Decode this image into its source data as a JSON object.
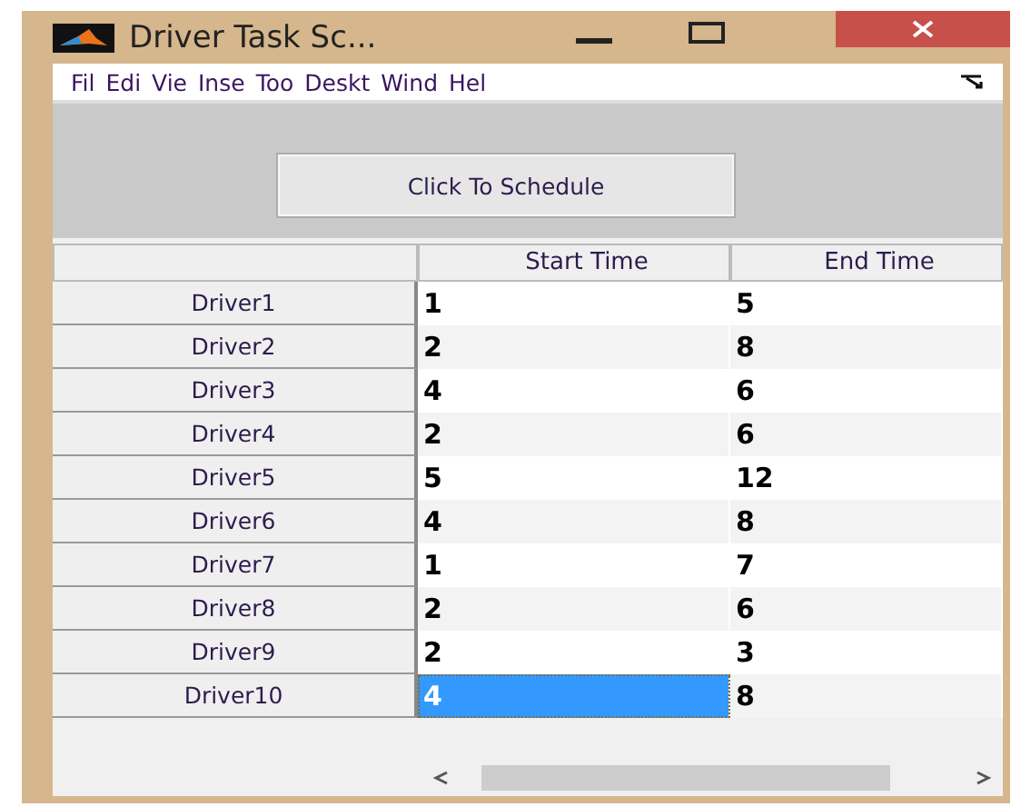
{
  "window": {
    "title": "Driver Task Sc..."
  },
  "menu": [
    {
      "label": "Fil"
    },
    {
      "label": "Edi"
    },
    {
      "label": "Vie"
    },
    {
      "label": "Inse"
    },
    {
      "label": "Too"
    },
    {
      "label": "Deskt"
    },
    {
      "label": "Wind"
    },
    {
      "label": "Hel"
    }
  ],
  "button": {
    "label": "Click To Schedule"
  },
  "table": {
    "columns": [
      "Start Time",
      "End Time"
    ],
    "rows": [
      {
        "header": "Driver1",
        "cells": [
          {
            "value": "1",
            "selected": false
          },
          {
            "value": "5",
            "selected": false
          }
        ]
      },
      {
        "header": "Driver2",
        "cells": [
          {
            "value": "2",
            "selected": false
          },
          {
            "value": "8",
            "selected": false
          }
        ]
      },
      {
        "header": "Driver3",
        "cells": [
          {
            "value": "4",
            "selected": false
          },
          {
            "value": "6",
            "selected": false
          }
        ]
      },
      {
        "header": "Driver4",
        "cells": [
          {
            "value": "2",
            "selected": false
          },
          {
            "value": "6",
            "selected": false
          }
        ]
      },
      {
        "header": "Driver5",
        "cells": [
          {
            "value": "5",
            "selected": false
          },
          {
            "value": "12",
            "selected": false
          }
        ]
      },
      {
        "header": "Driver6",
        "cells": [
          {
            "value": "4",
            "selected": false
          },
          {
            "value": "8",
            "selected": false
          }
        ]
      },
      {
        "header": "Driver7",
        "cells": [
          {
            "value": "1",
            "selected": false
          },
          {
            "value": "7",
            "selected": false
          }
        ]
      },
      {
        "header": "Driver8",
        "cells": [
          {
            "value": "2",
            "selected": false
          },
          {
            "value": "6",
            "selected": false
          }
        ]
      },
      {
        "header": "Driver9",
        "cells": [
          {
            "value": "2",
            "selected": false
          },
          {
            "value": "3",
            "selected": false
          }
        ]
      },
      {
        "header": "Driver10",
        "cells": [
          {
            "value": "4",
            "selected": true
          },
          {
            "value": "8",
            "selected": false
          }
        ]
      }
    ]
  }
}
